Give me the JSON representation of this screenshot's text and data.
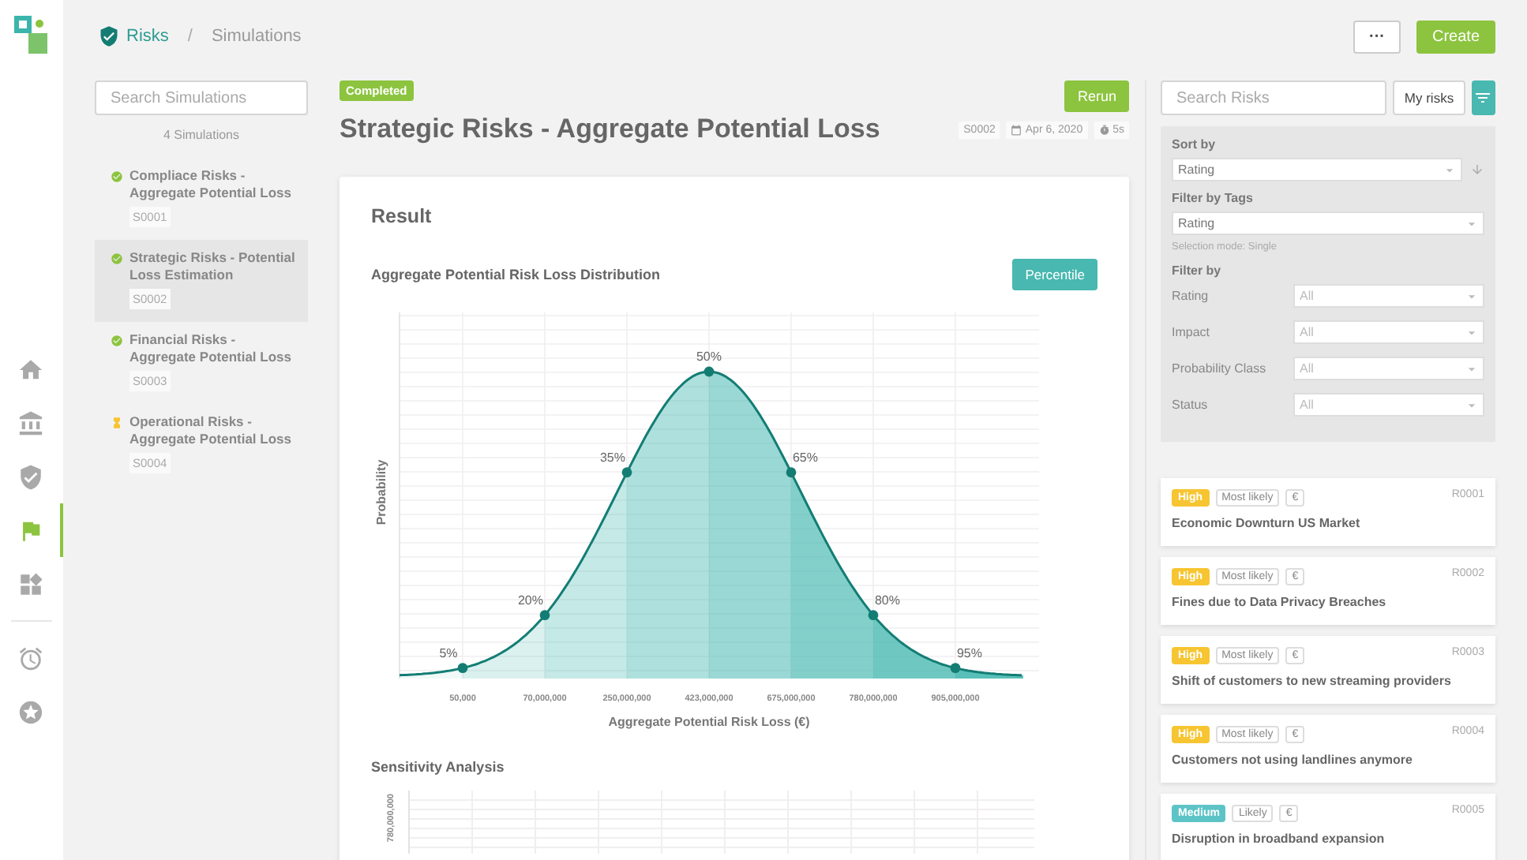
{
  "nav": {
    "items": [
      {
        "kind": "home",
        "selected": false
      },
      {
        "kind": "bank",
        "selected": false
      },
      {
        "kind": "shield",
        "selected": false
      },
      {
        "kind": "flag",
        "selected": true
      },
      {
        "kind": "widgets",
        "selected": false
      },
      {
        "kind": "alarm",
        "selected": false
      },
      {
        "kind": "star",
        "selected": false
      }
    ]
  },
  "breadcrumb": [
    "Risks",
    "Simulations"
  ],
  "breadcrumb_separator": "/",
  "header_actions": [
    {
      "kind": "more",
      "label": "···"
    },
    {
      "kind": "primary",
      "label": "Create"
    }
  ],
  "simulations": {
    "search": {
      "placeholder": "Search Simulations"
    },
    "count": "4 Simulations",
    "items": [
      {
        "title": "Compliace Risks - Aggregate Potential Loss",
        "id": "S0001",
        "done": true,
        "selected": false
      },
      {
        "title": "Strategic Risks - Potential Loss Estimation",
        "id": "S0002",
        "done": true,
        "selected": true
      },
      {
        "title": "Financial Risks - Aggregate Potential Loss",
        "id": "S0003",
        "done": true,
        "selected": false
      },
      {
        "title": "Operational Risks - Aggregate Potential Loss",
        "id": "S0004",
        "done": false,
        "selected": false
      }
    ]
  },
  "detail": {
    "status": "Completed",
    "title": "Strategic Risks - Aggregate Potential Loss",
    "rerun": "Rerun",
    "id": "S0002",
    "date": "Apr 6, 2020",
    "duration": "5s",
    "result": {
      "heading": "Result",
      "distribution": {
        "title": "Aggregate Potential Risk Loss Distribution",
        "button": "Percentile",
        "ylabel": "Probability",
        "xlabel": "Aggregate Potential Risk Loss (€)",
        "x_ticks": [
          "50,000",
          "70,000,000",
          "250,000,000",
          "423,000,000",
          "675,000,000",
          "780,000,000",
          "905,000,000"
        ],
        "percentiles": [
          "5%",
          "20%",
          "35%",
          "50%",
          "65%",
          "80%",
          "95%"
        ]
      },
      "sensitivity": {
        "title": "Sensitivity Analysis",
        "y_tick": "780,000,000"
      }
    }
  },
  "risks": {
    "search": {
      "placeholder": "Search Risks"
    },
    "my_risks": "My risks",
    "filters": {
      "sort_label": "Sort by",
      "sort_value": "Rating",
      "tags_label": "Filter by Tags",
      "tags_value": "Rating",
      "selection_mode": "Selection mode: Single",
      "filter_label": "Filter by",
      "fields": [
        {
          "label": "Rating",
          "value": "All"
        },
        {
          "label": "Impact",
          "value": "All"
        },
        {
          "label": "Probability Class",
          "value": "All"
        },
        {
          "label": "Status",
          "value": "All"
        }
      ]
    },
    "items": [
      {
        "rating": "High",
        "color": "#f7c531",
        "likelihood": "Most likely",
        "currency": "€",
        "id": "R0001",
        "title": "Economic Downturn US Market"
      },
      {
        "rating": "High",
        "color": "#f7c531",
        "likelihood": "Most likely",
        "currency": "€",
        "id": "R0002",
        "title": "Fines due to Data Privacy Breaches"
      },
      {
        "rating": "High",
        "color": "#f7c531",
        "likelihood": "Most likely",
        "currency": "€",
        "id": "R0003",
        "title": "Shift of customers to new streaming providers"
      },
      {
        "rating": "High",
        "color": "#f7c531",
        "likelihood": "Most likely",
        "currency": "€",
        "id": "R0004",
        "title": "Customers not using landlines anymore"
      },
      {
        "rating": "Medium",
        "color": "#5cc4c6",
        "likelihood": "Likely",
        "currency": "€",
        "id": "R0005",
        "title": "Disruption in broadband expansion"
      }
    ]
  }
}
